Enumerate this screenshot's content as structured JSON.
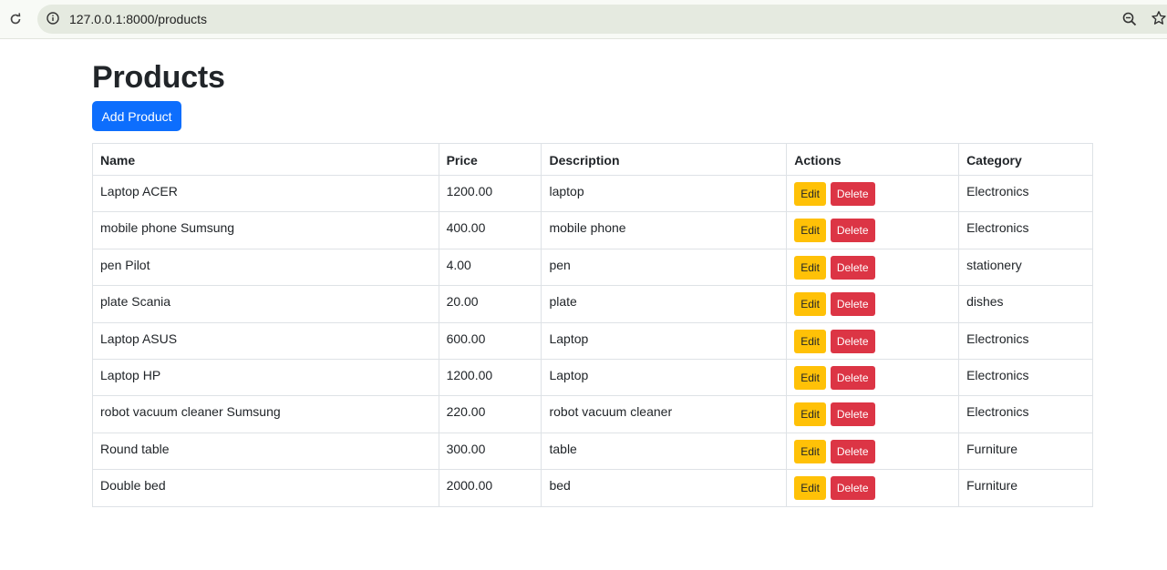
{
  "browser": {
    "url": "127.0.0.1:8000/products"
  },
  "page": {
    "title": "Products",
    "add_button_label": "Add Product"
  },
  "table": {
    "headers": [
      "Name",
      "Price",
      "Description",
      "Actions",
      "Category"
    ],
    "edit_label": "Edit",
    "delete_label": "Delete",
    "rows": [
      {
        "name": "Laptop ACER",
        "price": "1200.00",
        "description": "laptop",
        "category": "Electronics"
      },
      {
        "name": "mobile phone Sumsung",
        "price": "400.00",
        "description": "mobile phone",
        "category": "Electronics"
      },
      {
        "name": "pen Pilot",
        "price": "4.00",
        "description": "pen",
        "category": "stationery"
      },
      {
        "name": "plate Scania",
        "price": "20.00",
        "description": "plate",
        "category": "dishes"
      },
      {
        "name": "Laptop ASUS",
        "price": "600.00",
        "description": "Laptop",
        "category": "Electronics"
      },
      {
        "name": "Laptop HP",
        "price": "1200.00",
        "description": "Laptop",
        "category": "Electronics"
      },
      {
        "name": "robot vacuum cleaner Sumsung",
        "price": "220.00",
        "description": "robot vacuum cleaner",
        "category": "Electronics"
      },
      {
        "name": "Round table",
        "price": "300.00",
        "description": "table",
        "category": "Furniture"
      },
      {
        "name": "Double bed",
        "price": "2000.00",
        "description": "bed",
        "category": "Furniture"
      }
    ]
  },
  "colors": {
    "primary": "#0d6efd",
    "warning": "#ffc107",
    "danger": "#dc3545"
  },
  "icons": [
    "reload-icon",
    "site-info-icon",
    "zoom-icon",
    "bookmark-star-icon"
  ]
}
